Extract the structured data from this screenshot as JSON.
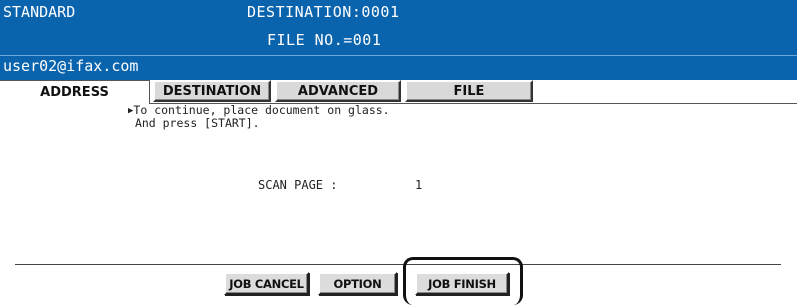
{
  "header": {
    "mode": "STANDARD",
    "destination": "DESTINATION:0001",
    "file_no": "FILE NO.=001",
    "user": "user02@ifax.com"
  },
  "tabs": [
    {
      "label": "ADDRESS",
      "active": true
    },
    {
      "label": "DESTINATION",
      "active": false
    },
    {
      "label": "ADVANCED",
      "active": false
    },
    {
      "label": "FILE",
      "active": false
    }
  ],
  "message": {
    "arrow": "▶",
    "line1": "To continue, place document on glass.",
    "line2": "And press [START]."
  },
  "scan": {
    "label": "SCAN PAGE :",
    "value": "1"
  },
  "buttons": {
    "job_cancel": "JOB CANCEL",
    "option": "OPTION",
    "job_finish": "JOB FINISH"
  },
  "colors": {
    "header_bg": "#0a63ad",
    "button_bg": "#dcdcdc"
  }
}
